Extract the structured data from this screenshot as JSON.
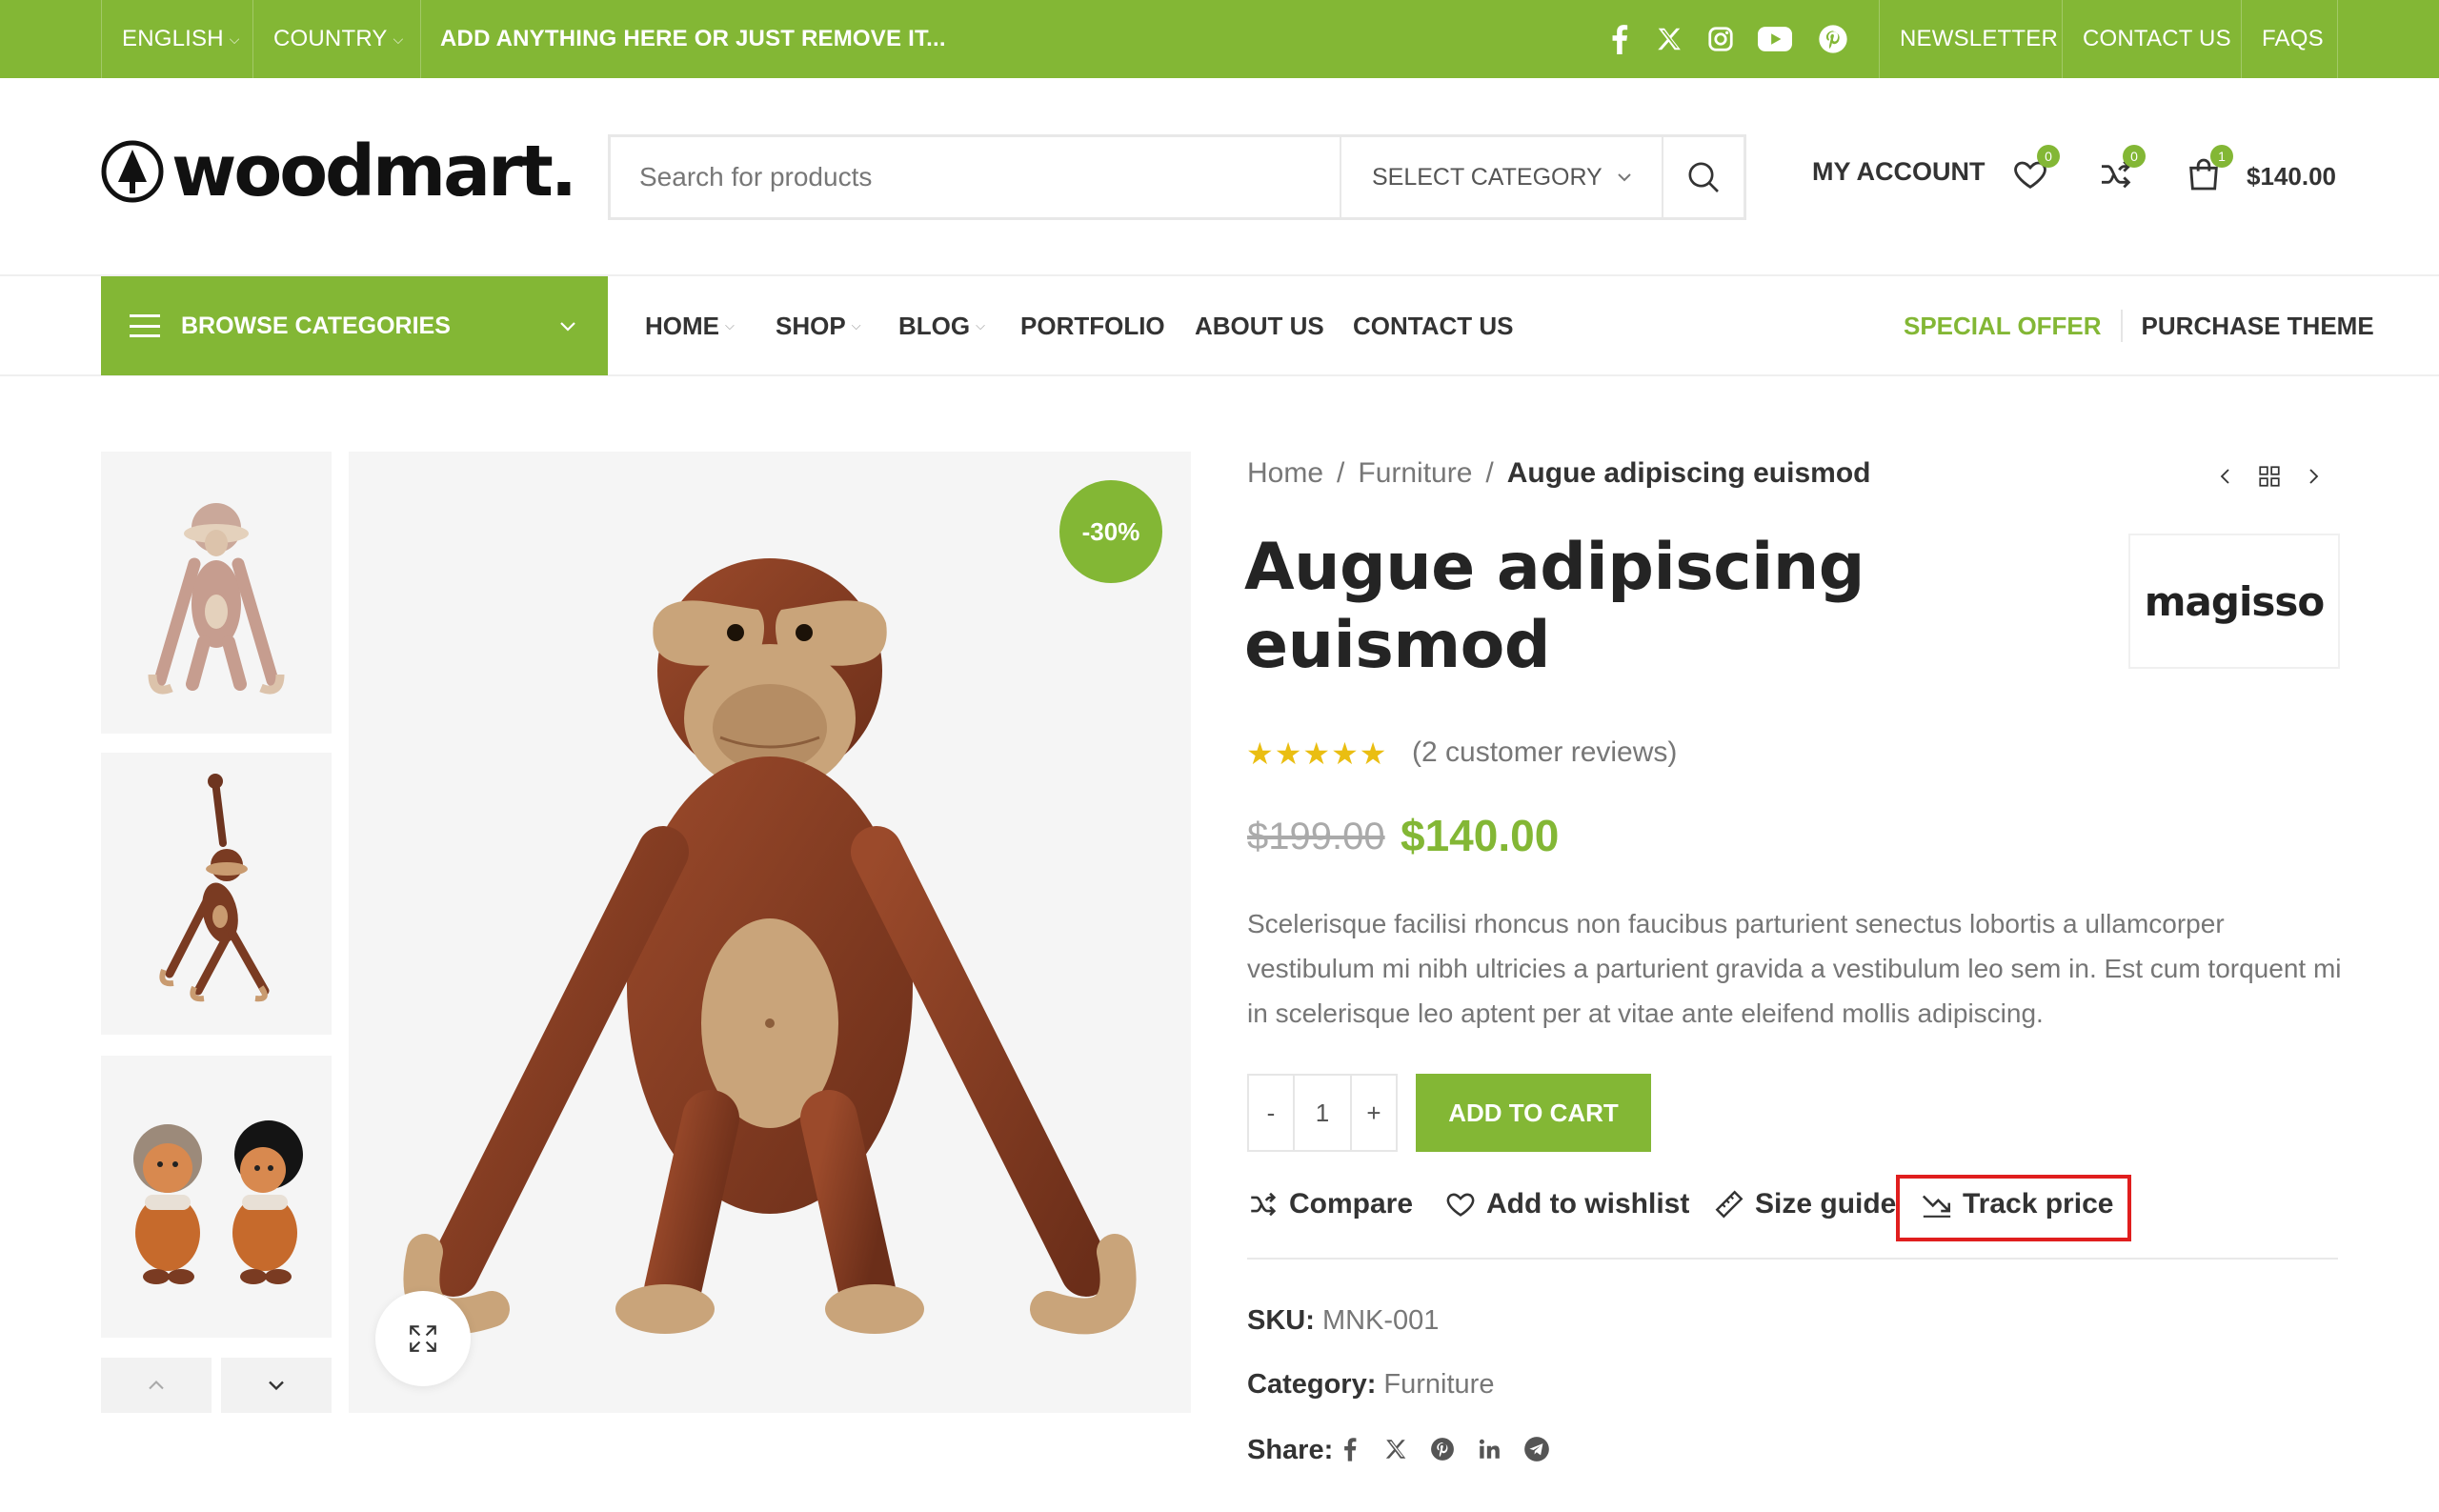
{
  "topbar": {
    "language": "ENGLISH",
    "country": "COUNTRY",
    "promo": "ADD ANYTHING HERE OR JUST REMOVE IT...",
    "social_icons": [
      "facebook-icon",
      "x-twitter-icon",
      "instagram-icon",
      "youtube-icon",
      "pinterest-icon"
    ],
    "links": [
      "NEWSLETTER",
      "CONTACT US",
      "FAQS"
    ]
  },
  "header": {
    "logo_text": "woodmart.",
    "search_placeholder": "Search for products",
    "category_select": "SELECT CATEGORY",
    "account": "MY ACCOUNT",
    "wishlist_count": "0",
    "compare_count": "0",
    "cart_count": "1",
    "cart_total": "$140.00"
  },
  "nav": {
    "browse": "BROWSE CATEGORIES",
    "items": [
      "HOME",
      "SHOP",
      "BLOG",
      "PORTFOLIO",
      "ABOUT US",
      "CONTACT US"
    ],
    "special_offer": "SPECIAL OFFER",
    "purchase": "PURCHASE THEME"
  },
  "gallery": {
    "sale_badge": "-30%"
  },
  "product": {
    "breadcrumb": [
      "Home",
      "Furniture",
      "Augue adipiscing euismod"
    ],
    "title": "Augue adipiscing euismod",
    "brand": "magisso",
    "rating": 5,
    "reviews": "(2 customer reviews)",
    "old_price": "$199.00",
    "price": "$140.00",
    "description": "Scelerisque facilisi rhoncus non faucibus parturient senectus lobortis a ullamcorper vestibulum mi nibh ultricies a parturient gravida a vestibulum leo sem in. Est cum torquent mi in scelerisque leo aptent per at vitae ante eleifend mollis adipiscing.",
    "quantity": "1",
    "qty_minus": "-",
    "qty_plus": "+",
    "add_to_cart": "ADD TO CART",
    "actions": {
      "compare": "Compare",
      "wishlist": "Add to wishlist",
      "size_guide": "Size guide",
      "track_price": "Track price"
    },
    "sku_label": "SKU:",
    "sku": "MNK-001",
    "category_label": "Category:",
    "category": "Furniture",
    "share_label": "Share:",
    "share_icons": [
      "facebook-icon",
      "x-twitter-icon",
      "pinterest-icon",
      "linkedin-icon",
      "telegram-icon"
    ]
  },
  "colors": {
    "accent": "#83b735",
    "highlight": "#e01e1e",
    "star": "#eabe12"
  }
}
